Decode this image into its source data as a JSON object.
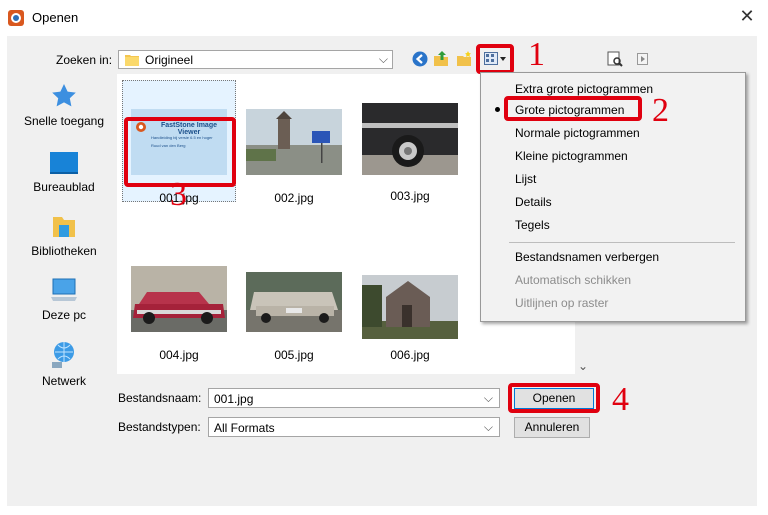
{
  "window": {
    "title": "Openen",
    "close_icon": "close-icon"
  },
  "toolbar": {
    "look_in_label": "Zoeken in:",
    "look_in_value": "Origineel"
  },
  "places": [
    {
      "label": "Snelle toegang",
      "icon": "star-icon"
    },
    {
      "label": "Bureaublad",
      "icon": "desktop-icon"
    },
    {
      "label": "Bibliotheken",
      "icon": "library-folder-icon"
    },
    {
      "label": "Deze pc",
      "icon": "computer-icon"
    },
    {
      "label": "Netwerk",
      "icon": "network-icon"
    }
  ],
  "files": [
    {
      "name": "001.jpg",
      "preview_title": "FastStone Image Viewer",
      "preview_sub1": "Handleiding bij versie 6.5 en hoger",
      "preview_sub2": "Ruud van den Berg"
    },
    {
      "name": "002.jpg"
    },
    {
      "name": "003.jpg"
    },
    {
      "name": "004.jpg"
    },
    {
      "name": "005.jpg"
    },
    {
      "name": "006.jpg"
    }
  ],
  "view_menu": {
    "items": [
      {
        "label": "Extra grote pictogrammen",
        "disabled": false,
        "selected": false
      },
      {
        "label": "Grote pictogrammen",
        "disabled": false,
        "selected": true
      },
      {
        "label": "Normale pictogrammen",
        "disabled": false,
        "selected": false
      },
      {
        "label": "Kleine pictogrammen",
        "disabled": false,
        "selected": false
      },
      {
        "label": "Lijst",
        "disabled": false,
        "selected": false
      },
      {
        "label": "Details",
        "disabled": false,
        "selected": false
      },
      {
        "label": "Tegels",
        "disabled": false,
        "selected": false
      },
      {
        "label": "Bestandsnamen verbergen",
        "disabled": false,
        "selected": false
      },
      {
        "label": "Automatisch schikken",
        "disabled": true,
        "selected": false
      },
      {
        "label": "Uitlijnen op raster",
        "disabled": true,
        "selected": false
      }
    ]
  },
  "bottom": {
    "filename_label": "Bestandsnaam:",
    "filename_value": "001.jpg",
    "filetype_label": "Bestandstypen:",
    "filetype_value": "All Formats",
    "open_button": "Openen",
    "cancel_button": "Annuleren"
  },
  "annotations": {
    "n1": "1",
    "n2": "2",
    "n3": "3",
    "n4": "4",
    "color": "#e0000f"
  }
}
